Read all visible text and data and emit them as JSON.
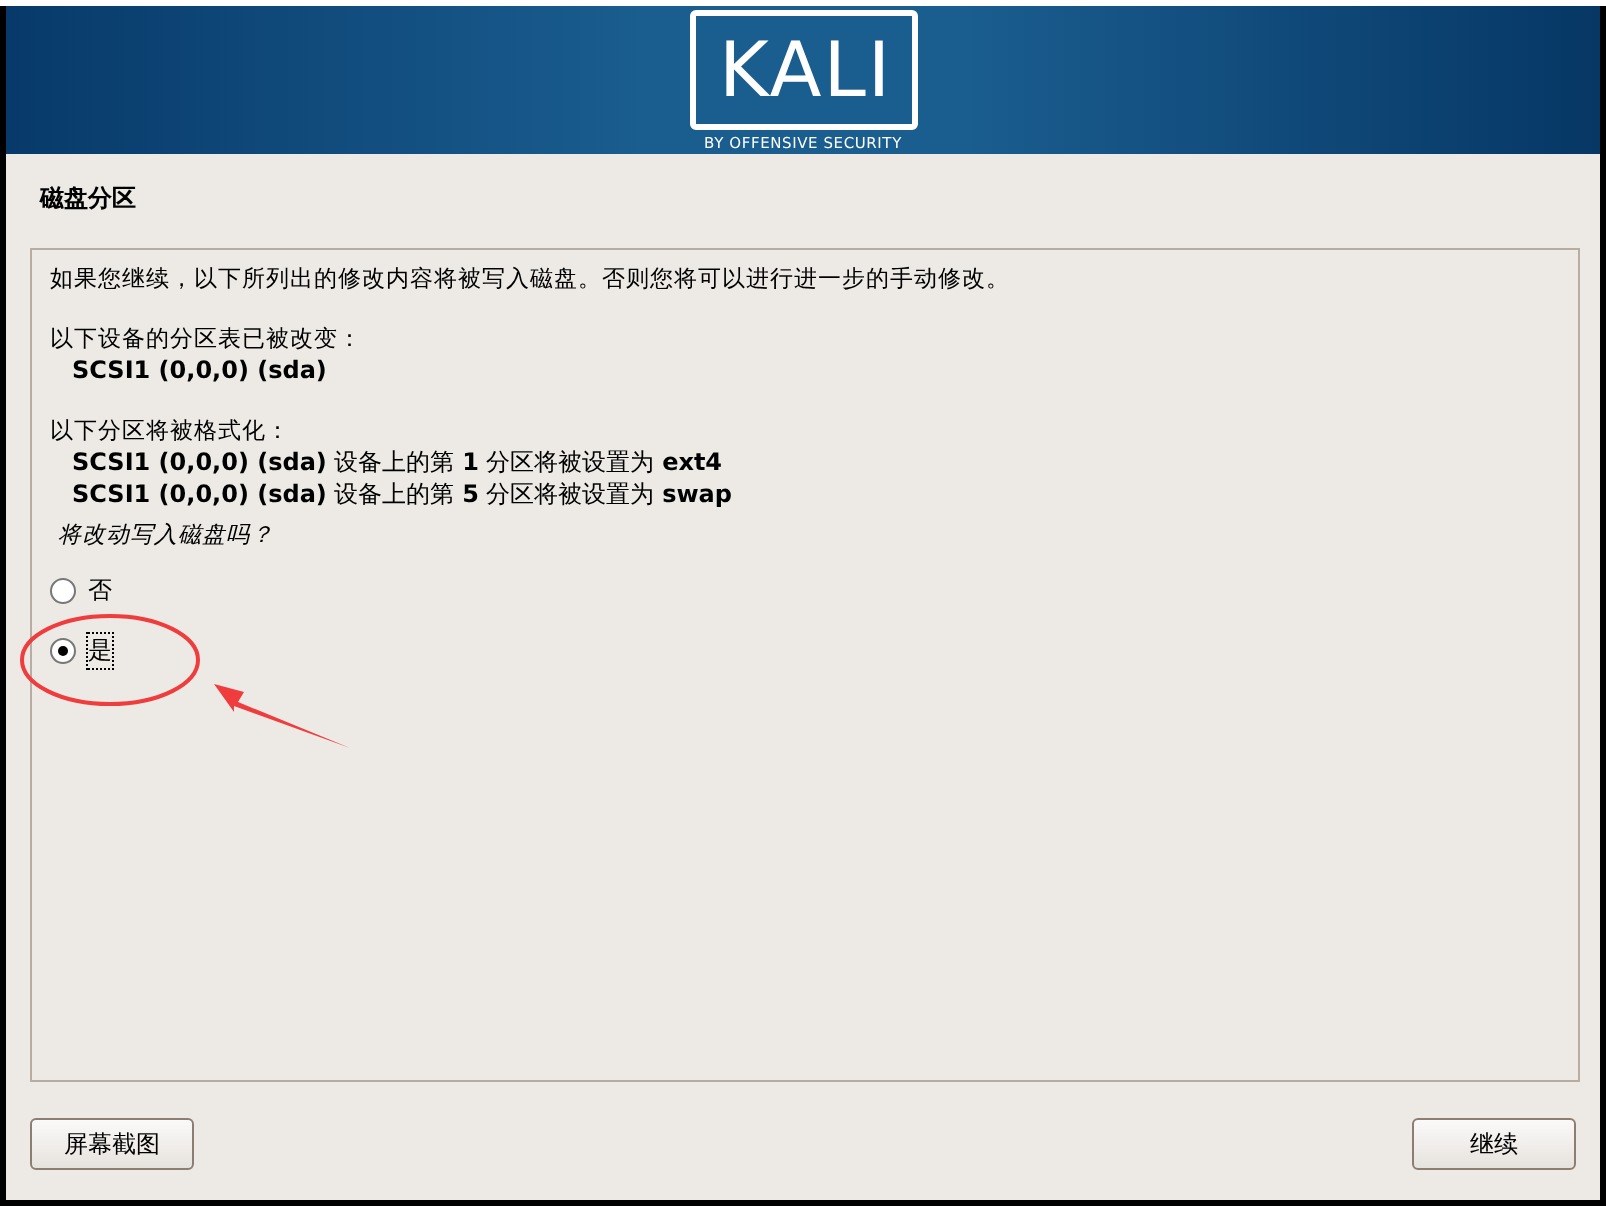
{
  "header": {
    "logo": "KALI",
    "tagline": "BY OFFENSIVE SECURITY"
  },
  "page_title": "磁盘分区",
  "content": [
    {
      "kind": "text",
      "text": "如果您继续，以下所列出的修改内容将被写入磁盘。否则您将可以进行进一步的手动修改。"
    },
    {
      "kind": "gap"
    },
    {
      "kind": "text",
      "text": "以下设备的分区表已被改变："
    },
    {
      "kind": "indent",
      "text": "**SCSI1 (0,0,0) (sda)**"
    },
    {
      "kind": "gap"
    },
    {
      "kind": "text",
      "text": "以下分区将被格式化："
    },
    {
      "kind": "indent",
      "text": "**SCSI1 (0,0,0) (sda)** 设备上的第 **1** 分区将被设置为 **ext4**"
    },
    {
      "kind": "indent",
      "text": "**SCSI1 (0,0,0) (sda)** 设备上的第 **5** 分区将被设置为 **swap**"
    },
    {
      "kind": "question",
      "text": "将改动写入磁盘吗？"
    }
  ],
  "options": [
    {
      "label": "否",
      "selected": false
    },
    {
      "label": "是",
      "selected": true
    }
  ],
  "buttons": {
    "left": "屏幕截图",
    "right": "继续"
  }
}
